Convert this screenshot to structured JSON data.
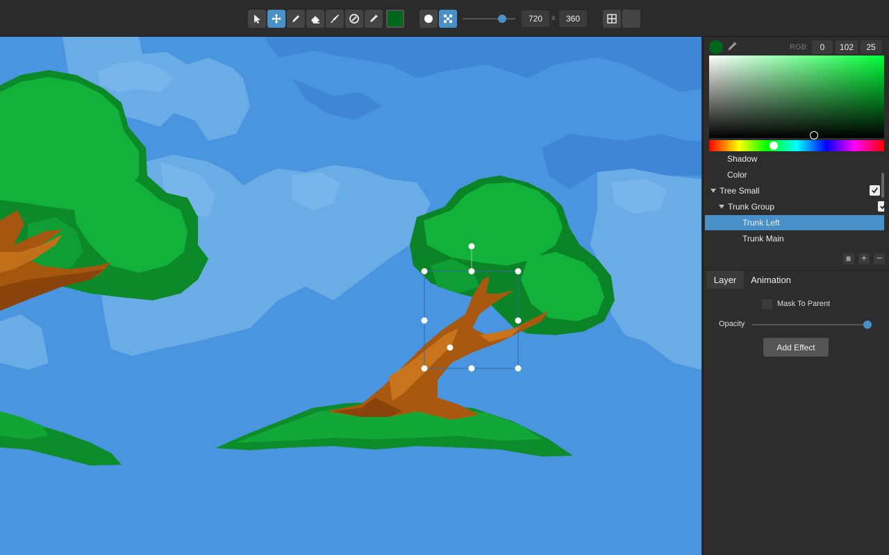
{
  "toolbar": {
    "tools": [
      {
        "name": "select-tool",
        "icon": "cursor-arrow-icon"
      },
      {
        "name": "move-tool",
        "icon": "move-arrows-icon",
        "active": true
      },
      {
        "name": "pencil-tool",
        "icon": "pencil-icon"
      },
      {
        "name": "eraser-tool",
        "icon": "eraser-icon"
      },
      {
        "name": "brush-tool",
        "icon": "brush-icon"
      },
      {
        "name": "fill-tool",
        "icon": "fill-icon"
      },
      {
        "name": "eyedropper-tool",
        "icon": "dropper-icon"
      }
    ],
    "current_color": "#006619",
    "brush_shapes": [
      {
        "name": "round-brush",
        "icon": "circle-icon"
      },
      {
        "name": "pixel-brush",
        "icon": "dots-pattern-icon",
        "active": true
      }
    ],
    "brush_size_fraction": 0.75,
    "width": "720",
    "height": "360",
    "size_separator": "x",
    "grid_icon": "grid-icon"
  },
  "color_picker": {
    "rgb_label": "RGB:",
    "r": "0",
    "g": "102",
    "b": "25",
    "swatch": "#006619",
    "hue_fraction": 0.37
  },
  "layers": [
    {
      "label": "Shadow",
      "indent": 1,
      "expanded": null,
      "checked": true
    },
    {
      "label": "Color",
      "indent": 1,
      "expanded": null,
      "checked": true
    },
    {
      "label": "Tree Small",
      "indent": 0,
      "expanded": true,
      "checked": true
    },
    {
      "label": "Trunk Group",
      "indent": 1,
      "expanded": true,
      "checked": true
    },
    {
      "label": "Trunk Left",
      "indent": 2,
      "expanded": null,
      "checked": true,
      "selected": true
    },
    {
      "label": "Trunk Main",
      "indent": 2,
      "expanded": null,
      "checked": true
    }
  ],
  "tabs": {
    "layer": "Layer",
    "animation": "Animation"
  },
  "properties": {
    "mask_to_parent": "Mask To Parent",
    "opacity_label": "Opacity",
    "opacity_fraction": 1.0,
    "add_effect": "Add Effect"
  }
}
